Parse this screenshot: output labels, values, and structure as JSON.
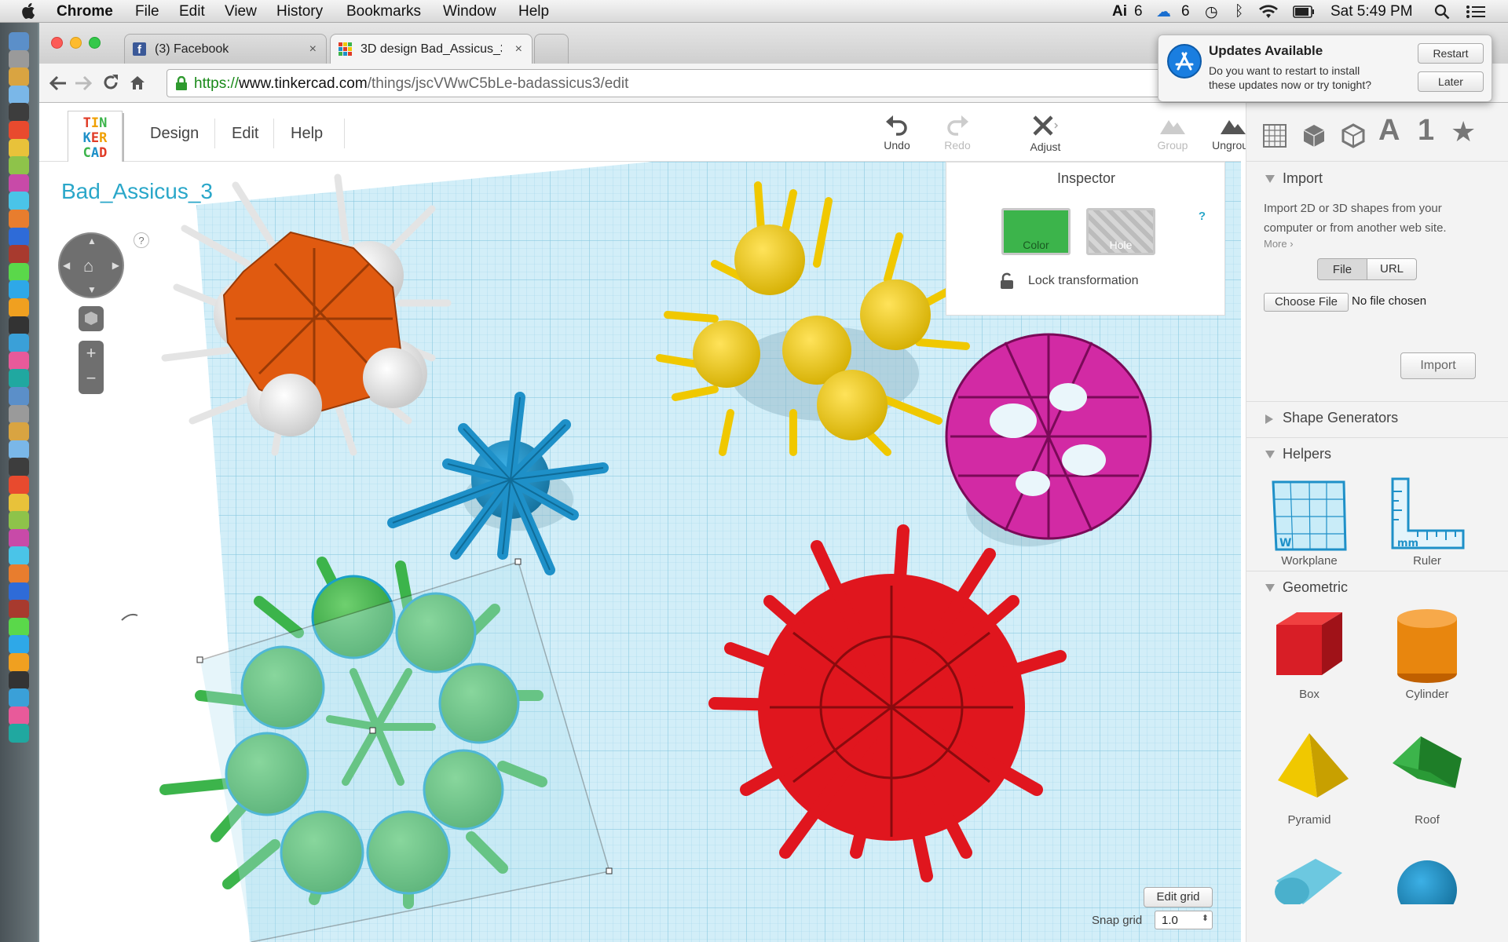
{
  "menubar": {
    "app": "Chrome",
    "items": [
      "File",
      "Edit",
      "View",
      "History",
      "Bookmarks",
      "Window",
      "Help"
    ],
    "status": {
      "adobe_count": "6",
      "cc_count": "6",
      "clock": "Sat 5:49 PM"
    }
  },
  "browser": {
    "tabs": [
      {
        "title": "(3) Facebook",
        "close": "×"
      },
      {
        "title": "3D design Bad_Assicus_3",
        "close": "×"
      }
    ],
    "url": {
      "scheme": "https://",
      "host": "www.tinkercad.com",
      "path": "/things/jscVWwC5bLe-badassicus3/edit"
    }
  },
  "notification": {
    "title": "Updates Available",
    "body_line1": "Do you want to restart to install",
    "body_line2": "these updates now or try tonight?",
    "restart": "Restart",
    "later": "Later"
  },
  "tinkercad": {
    "logo": [
      "T",
      "I",
      "N",
      "K",
      "E",
      "R",
      "C",
      "A",
      "D"
    ],
    "nav": [
      "Design",
      "Edit",
      "Help"
    ],
    "tools": {
      "undo": "Undo",
      "redo": "Redo",
      "adjust": "Adjust",
      "group": "Group",
      "ungroup": "Ungroup"
    },
    "design_title": "Bad_Assicus_3",
    "help_mark": "?",
    "inspector": {
      "title": "Inspector",
      "color": "Color",
      "hole": "Hole",
      "lock": "Lock transformation",
      "help": "?"
    },
    "grid": {
      "edit_grid": "Edit grid",
      "snap_label": "Snap grid",
      "snap_value": "1.0"
    }
  },
  "rightbar": {
    "top_glyph_text": "A",
    "top_glyph_num": "1",
    "import": {
      "title": "Import",
      "desc_line1": "Import 2D or 3D shapes from your",
      "desc_line2": "computer or from another web site.",
      "more": "More ›",
      "tab_file": "File",
      "tab_url": "URL",
      "choose_file": "Choose File",
      "no_file": "No file chosen",
      "import_button": "Import"
    },
    "shape_generators": "Shape Generators",
    "helpers": {
      "title": "Helpers",
      "items": [
        "Workplane",
        "Ruler"
      ]
    },
    "geometric": {
      "title": "Geometric",
      "items": [
        "Box",
        "Cylinder",
        "Pyramid",
        "Roof"
      ]
    }
  },
  "colors": {
    "accent": "#2aa7c9",
    "green": "#3cb44b",
    "orange": "#e05a10",
    "yellow": "#f0c800",
    "blue": "#1e90c8",
    "magenta": "#c0168c",
    "red": "#e0161e"
  }
}
